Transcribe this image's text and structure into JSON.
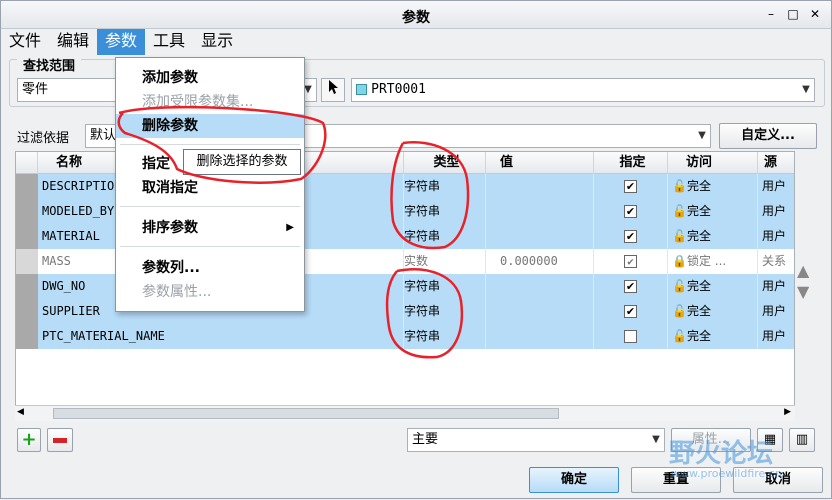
{
  "window": {
    "title": "参数"
  },
  "menubar": {
    "items": [
      "文件",
      "编辑",
      "参数",
      "工具",
      "显示"
    ]
  },
  "scope": {
    "group_label": "查找范围",
    "type_value": "零件",
    "model_value": "PRT0001"
  },
  "filter": {
    "label": "过滤依据",
    "value": "默认",
    "customize_label": "自定义..."
  },
  "table": {
    "headers": [
      "名称",
      "类型",
      "值",
      "指定",
      "访问",
      "源"
    ],
    "rows": [
      {
        "name": "DESCRIPTION",
        "type": "字符串",
        "value": "",
        "designated": true,
        "access": "完全",
        "source": "用户",
        "selected": true
      },
      {
        "name": "MODELED_BY",
        "type": "字符串",
        "value": "",
        "designated": true,
        "access": "完全",
        "source": "用户",
        "selected": true
      },
      {
        "name": "MATERIAL",
        "type": "字符串",
        "value": "",
        "designated": true,
        "access": "完全",
        "source": "用户",
        "selected": true
      },
      {
        "name": "MASS",
        "type": "实数",
        "value": "0.000000",
        "designated": true,
        "access": "锁定 ...",
        "source": "关系",
        "selected": false
      },
      {
        "name": "DWG_NO",
        "type": "字符串",
        "value": "",
        "designated": true,
        "access": "完全",
        "source": "用户",
        "selected": true
      },
      {
        "name": "SUPPLIER",
        "type": "字符串",
        "value": "",
        "designated": true,
        "access": "完全",
        "source": "用户",
        "selected": true
      },
      {
        "name": "PTC_MATERIAL_NAME",
        "type": "字符串",
        "value": "",
        "designated": false,
        "access": "完全",
        "source": "用户",
        "selected": true
      }
    ]
  },
  "menu_popup": {
    "items": [
      {
        "label": "添加参数",
        "disabled": false
      },
      {
        "label": "添加受限参数集...",
        "disabled": true
      },
      {
        "label": "删除参数",
        "disabled": false
      },
      {
        "label": "指定",
        "disabled": false
      },
      {
        "label": "取消指定",
        "disabled": false
      },
      {
        "label": "排序参数",
        "disabled": false
      },
      {
        "label": "参数列...",
        "disabled": false
      },
      {
        "label": "参数属性...",
        "disabled": true
      }
    ]
  },
  "tooltip": {
    "text": "删除选择的参数"
  },
  "bottom": {
    "main_value": "主要",
    "properties_label": "属性..."
  },
  "footer": {
    "ok": "确定",
    "reset": "重置",
    "cancel": "取消"
  },
  "watermark": {
    "text": "野火论坛",
    "url": "www.proewildfire.cn"
  },
  "colors": {
    "selection": "#b6dcf7",
    "menu_active": "#3b8fd9",
    "annotation": "#e8222a"
  }
}
